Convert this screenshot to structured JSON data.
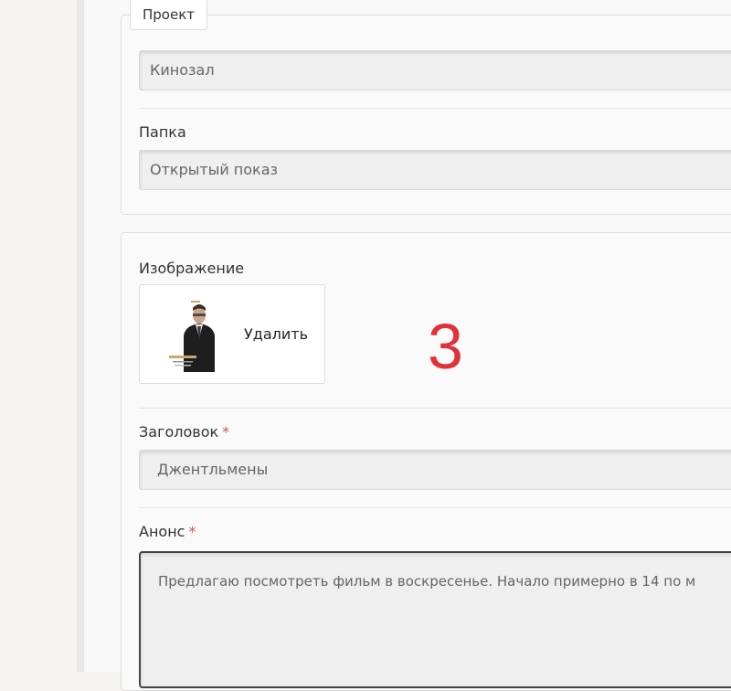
{
  "project": {
    "legend": "Проект",
    "value": "Кинозал"
  },
  "folder": {
    "label": "Папка",
    "value": "Открытый показ"
  },
  "image": {
    "label": "Изображение",
    "delete_label": "Удалить"
  },
  "annotation": "3",
  "title_field": {
    "label": "Заголовок",
    "required_mark": "*",
    "value": "Джентльмены"
  },
  "announce_field": {
    "label": "Анонс",
    "required_mark": "*",
    "value": "Предлагаю посмотреть фильм в воскресенье. Начало примерно в 14 по м"
  },
  "colors": {
    "required": "#d9534f",
    "annotation": "#e0313b"
  }
}
